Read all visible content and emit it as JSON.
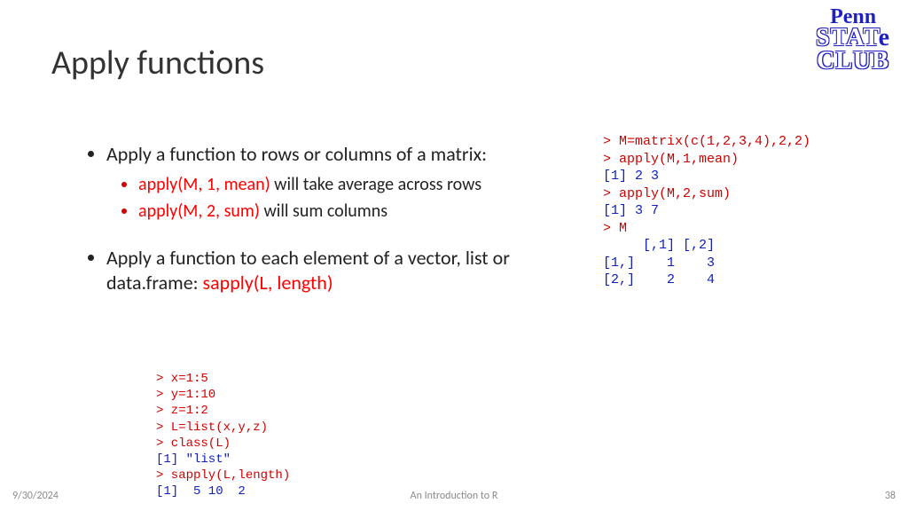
{
  "title": "Apply functions",
  "logo": {
    "line1": "Penn",
    "line2a": "STAT",
    "line2b": "e",
    "line3": "CLUB"
  },
  "bullets": {
    "b1": "Apply a function to rows or columns of a matrix:",
    "b1a_code": "apply(M, 1, mean)",
    "b1a_rest": " will take average across rows",
    "b1b_code": "apply(M, 2, sum)",
    "b1b_rest": " will sum columns",
    "b2_pre": "Apply a function to each element of a vector, list or data.frame: ",
    "b2_code": "sapply(L, length)"
  },
  "code_right": {
    "l1": "> M=matrix(c(1,2,3,4),2,2)",
    "l2": "> apply(M,1,mean)",
    "l3": "[1] 2 3",
    "l4": "> apply(M,2,sum)",
    "l5": "[1] 3 7",
    "l6": "> M",
    "l7": "     [,1] [,2]",
    "l8": "[1,]    1    3",
    "l9": "[2,]    2    4"
  },
  "code_bottom": {
    "l1": "> x=1:5",
    "l2": "> y=1:10",
    "l3": "> z=1:2",
    "l4": "> L=list(x,y,z)",
    "l5": "> class(L)",
    "l6": "[1] \"list\"",
    "l7": "> sapply(L,length)",
    "l8": "[1]  5 10  2"
  },
  "footer": {
    "date": "9/30/2024",
    "center": "An Introduction to R",
    "page": "38"
  }
}
